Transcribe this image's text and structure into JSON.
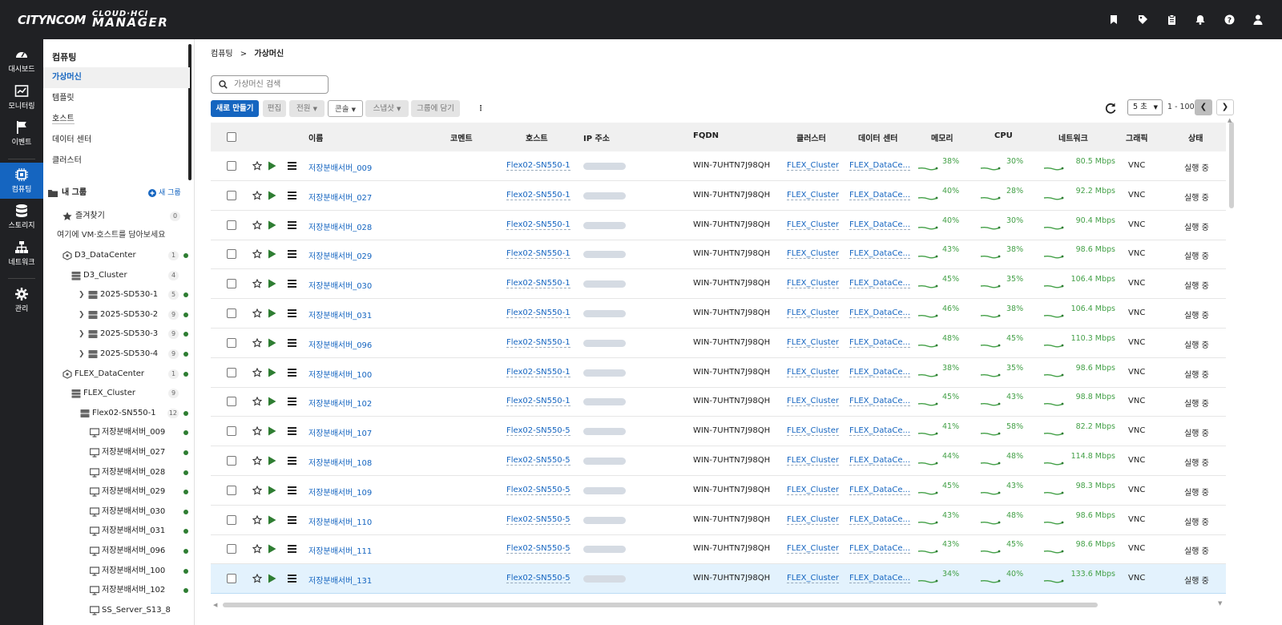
{
  "brand": {
    "name_a": "CITYNCOM",
    "name_b1": "CLOUD·HCI",
    "name_b2": "MANAGER"
  },
  "topbar_icons": [
    "bookmark-icon",
    "tag-icon",
    "clipboard-icon",
    "bell-icon",
    "help-icon",
    "user-icon"
  ],
  "nav": [
    {
      "label": "대시보드",
      "icon": "gauge-icon"
    },
    {
      "label": "모니터링",
      "icon": "chart-icon"
    },
    {
      "label": "이벤트",
      "icon": "flag-icon"
    },
    {
      "label": "컴퓨팅",
      "icon": "chip-icon",
      "active": true
    },
    {
      "label": "스토리지",
      "icon": "database-icon"
    },
    {
      "label": "네트워크",
      "icon": "network-icon"
    },
    {
      "label": "관리",
      "icon": "gear-icon"
    }
  ],
  "sidebar": {
    "title": "컴퓨팅",
    "menu": [
      "가상머신",
      "템플릿",
      "호스트",
      "데이터 센터",
      "클러스터"
    ],
    "group_title": "내 그룹",
    "new_group": "새 그룹",
    "favorites": {
      "label": "즐겨찾기",
      "count": "0"
    },
    "hint": "여기에 VM·호스트를 담아보세요",
    "tree": [
      {
        "label": "D3_DataCenter",
        "count": "1",
        "dot": true,
        "icon": "datacenter-icon",
        "level": 0
      },
      {
        "label": "D3_Cluster",
        "count": "4",
        "dot": false,
        "icon": "cluster-icon",
        "level": 1
      },
      {
        "label": "2025-SD530-1",
        "count": "5",
        "dot": true,
        "icon": "server-icon",
        "level": 2,
        "chev": true
      },
      {
        "label": "2025-SD530-2",
        "count": "9",
        "dot": true,
        "icon": "server-icon",
        "level": 2,
        "chev": true
      },
      {
        "label": "2025-SD530-3",
        "count": "9",
        "dot": true,
        "icon": "server-icon",
        "level": 2,
        "chev": true
      },
      {
        "label": "2025-SD530-4",
        "count": "9",
        "dot": true,
        "icon": "server-icon",
        "level": 2,
        "chev": true
      },
      {
        "label": "FLEX_DataCenter",
        "count": "1",
        "dot": true,
        "icon": "datacenter-icon",
        "level": 0
      },
      {
        "label": "FLEX_Cluster",
        "count": "9",
        "dot": false,
        "icon": "cluster-icon",
        "level": 1
      },
      {
        "label": "Flex02-SN550-1",
        "count": "12",
        "dot": true,
        "icon": "server-icon",
        "level": 2
      },
      {
        "label": "저장분배서버_009",
        "dot": true,
        "icon": "monitor-icon",
        "level": 3
      },
      {
        "label": "저장분배서버_027",
        "dot": true,
        "icon": "monitor-icon",
        "level": 3
      },
      {
        "label": "저장분배서버_028",
        "dot": true,
        "icon": "monitor-icon",
        "level": 3
      },
      {
        "label": "저장분배서버_029",
        "dot": true,
        "icon": "monitor-icon",
        "level": 3
      },
      {
        "label": "저장분배서버_030",
        "dot": true,
        "icon": "monitor-icon",
        "level": 3
      },
      {
        "label": "저장분배서버_031",
        "dot": true,
        "icon": "monitor-icon",
        "level": 3
      },
      {
        "label": "저장분배서버_096",
        "dot": true,
        "icon": "monitor-icon",
        "level": 3
      },
      {
        "label": "저장분배서버_100",
        "dot": true,
        "icon": "monitor-icon",
        "level": 3
      },
      {
        "label": "저장분배서버_102",
        "dot": true,
        "icon": "monitor-icon",
        "level": 3
      },
      {
        "label": "SS_Server_S13_8",
        "dot": false,
        "icon": "monitor-icon",
        "level": 3
      }
    ]
  },
  "breadcrumb": {
    "parent": "컴퓨팅",
    "separator": ">",
    "current": "가상머신"
  },
  "search": {
    "placeholder": "가상머신 검색"
  },
  "toolbar": {
    "create": "새로 만들기",
    "edit": "편집",
    "power": "전원",
    "console": "콘솔",
    "snapshot": "스냅샷",
    "add_group": "그룹에 담기",
    "more": "⋮"
  },
  "pagination": {
    "interval": "5 초",
    "range": "1 - 100"
  },
  "columns": {
    "name": "이름",
    "comment": "코멘트",
    "host": "호스트",
    "ip": "IP 주소",
    "fqdn": "FQDN",
    "cluster": "클러스터",
    "datacenter": "데이터 센터",
    "memory": "메모리",
    "cpu": "CPU",
    "network": "네트워크",
    "graphics": "그래픽",
    "status": "상태"
  },
  "rows": [
    {
      "name": "저장분배서버_009",
      "host": "Flex02-SN550-1",
      "fqdn": "WIN-7UHTN7J98QH",
      "cluster": "FLEX_Cluster",
      "datacenter": "FLEX_DataCe...",
      "memory": "38%",
      "cpu": "30%",
      "network": "80.5 Mbps",
      "graphics": "VNC",
      "status": "실행 중"
    },
    {
      "name": "저장분배서버_027",
      "host": "Flex02-SN550-1",
      "fqdn": "WIN-7UHTN7J98QH",
      "cluster": "FLEX_Cluster",
      "datacenter": "FLEX_DataCe...",
      "memory": "40%",
      "cpu": "28%",
      "network": "92.2 Mbps",
      "graphics": "VNC",
      "status": "실행 중"
    },
    {
      "name": "저장분배서버_028",
      "host": "Flex02-SN550-1",
      "fqdn": "WIN-7UHTN7J98QH",
      "cluster": "FLEX_Cluster",
      "datacenter": "FLEX_DataCe...",
      "memory": "40%",
      "cpu": "30%",
      "network": "90.4 Mbps",
      "graphics": "VNC",
      "status": "실행 중"
    },
    {
      "name": "저장분배서버_029",
      "host": "Flex02-SN550-1",
      "fqdn": "WIN-7UHTN7J98QH",
      "cluster": "FLEX_Cluster",
      "datacenter": "FLEX_DataCe...",
      "memory": "43%",
      "cpu": "38%",
      "network": "98.6 Mbps",
      "graphics": "VNC",
      "status": "실행 중"
    },
    {
      "name": "저장분배서버_030",
      "host": "Flex02-SN550-1",
      "fqdn": "WIN-7UHTN7J98QH",
      "cluster": "FLEX_Cluster",
      "datacenter": "FLEX_DataCe...",
      "memory": "45%",
      "cpu": "35%",
      "network": "106.4 Mbps",
      "graphics": "VNC",
      "status": "실행 중"
    },
    {
      "name": "저장분배서버_031",
      "host": "Flex02-SN550-1",
      "fqdn": "WIN-7UHTN7J98QH",
      "cluster": "FLEX_Cluster",
      "datacenter": "FLEX_DataCe...",
      "memory": "46%",
      "cpu": "38%",
      "network": "106.4 Mbps",
      "graphics": "VNC",
      "status": "실행 중"
    },
    {
      "name": "저장분배서버_096",
      "host": "Flex02-SN550-1",
      "fqdn": "WIN-7UHTN7J98QH",
      "cluster": "FLEX_Cluster",
      "datacenter": "FLEX_DataCe...",
      "memory": "48%",
      "cpu": "45%",
      "network": "110.3 Mbps",
      "graphics": "VNC",
      "status": "실행 중"
    },
    {
      "name": "저장분배서버_100",
      "host": "Flex02-SN550-1",
      "fqdn": "WIN-7UHTN7J98QH",
      "cluster": "FLEX_Cluster",
      "datacenter": "FLEX_DataCe...",
      "memory": "38%",
      "cpu": "35%",
      "network": "98.6 Mbps",
      "graphics": "VNC",
      "status": "실행 중"
    },
    {
      "name": "저장분배서버_102",
      "host": "Flex02-SN550-1",
      "fqdn": "WIN-7UHTN7J98QH",
      "cluster": "FLEX_Cluster",
      "datacenter": "FLEX_DataCe...",
      "memory": "45%",
      "cpu": "43%",
      "network": "98.8 Mbps",
      "graphics": "VNC",
      "status": "실행 중"
    },
    {
      "name": "저장분배서버_107",
      "host": "Flex02-SN550-5",
      "fqdn": "WIN-7UHTN7J98QH",
      "cluster": "FLEX_Cluster",
      "datacenter": "FLEX_DataCe...",
      "memory": "41%",
      "cpu": "58%",
      "network": "82.2 Mbps",
      "graphics": "VNC",
      "status": "실행 중"
    },
    {
      "name": "저장분배서버_108",
      "host": "Flex02-SN550-5",
      "fqdn": "WIN-7UHTN7J98QH",
      "cluster": "FLEX_Cluster",
      "datacenter": "FLEX_DataCe...",
      "memory": "44%",
      "cpu": "48%",
      "network": "114.8 Mbps",
      "graphics": "VNC",
      "status": "실행 중"
    },
    {
      "name": "저장분배서버_109",
      "host": "Flex02-SN550-5",
      "fqdn": "WIN-7UHTN7J98QH",
      "cluster": "FLEX_Cluster",
      "datacenter": "FLEX_DataCe...",
      "memory": "45%",
      "cpu": "43%",
      "network": "98.3 Mbps",
      "graphics": "VNC",
      "status": "실행 중"
    },
    {
      "name": "저장분배서버_110",
      "host": "Flex02-SN550-5",
      "fqdn": "WIN-7UHTN7J98QH",
      "cluster": "FLEX_Cluster",
      "datacenter": "FLEX_DataCe...",
      "memory": "43%",
      "cpu": "48%",
      "network": "98.6 Mbps",
      "graphics": "VNC",
      "status": "실행 중"
    },
    {
      "name": "저장분배서버_111",
      "host": "Flex02-SN550-5",
      "fqdn": "WIN-7UHTN7J98QH",
      "cluster": "FLEX_Cluster",
      "datacenter": "FLEX_DataCe...",
      "memory": "43%",
      "cpu": "45%",
      "network": "98.6 Mbps",
      "graphics": "VNC",
      "status": "실행 중"
    },
    {
      "name": "저장분배서버_131",
      "host": "Flex02-SN550-5",
      "fqdn": "WIN-7UHTN7J98QH",
      "cluster": "FLEX_Cluster",
      "datacenter": "FLEX_DataCe...",
      "memory": "34%",
      "cpu": "40%",
      "network": "133.6 Mbps",
      "graphics": "VNC",
      "status": "실행 중",
      "selected": true
    }
  ],
  "colors": {
    "topbar": "#202124",
    "accent": "#1565c0",
    "ok": "#2e7d32",
    "spark": "#43a047"
  }
}
